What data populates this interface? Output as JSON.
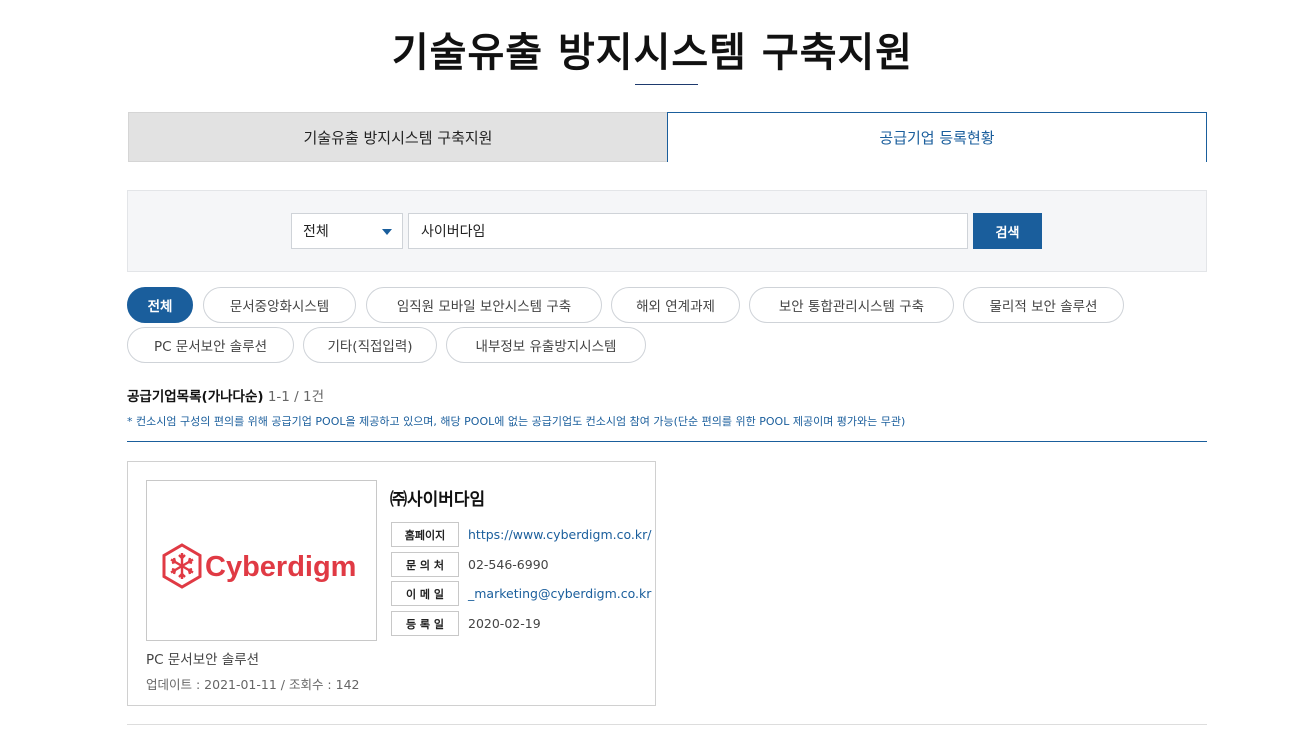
{
  "page": {
    "title": "기술유출 방지시스템 구축지원"
  },
  "tabs": [
    {
      "label": "기술유출 방지시스템 구축지원"
    },
    {
      "label": "공급기업 등록현황"
    }
  ],
  "search": {
    "select_value": "전체",
    "input_value": "사이버다임",
    "button_label": "검색"
  },
  "categories": [
    "전체",
    "문서중앙화시스템",
    "임직원 모바일 보안시스템 구축",
    "해외 연계과제",
    "보안 통합관리시스템 구축",
    "물리적 보안 솔루션",
    "PC 문서보안 솔루션",
    "기타(직접입력)",
    "내부정보 유출방지시스템"
  ],
  "list": {
    "title": "공급기업목록(가나다순)",
    "count": "1-1 / 1건",
    "notice": "* 컨소시엄 구성의 편의를 위해 공급기업 POOL을 제공하고 있으며, 해당 POOL에 없는 공급기업도 컨소시엄 참여 가능(단순 편의를 위한 POOL 제공이며 평가와는 무관)"
  },
  "company": {
    "name": "㈜사이버다임",
    "logo_text": "Cyberdigm",
    "info": [
      {
        "label": "홈페이지",
        "value": "https://www.cyberdigm.co.kr/"
      },
      {
        "label": "문 의 처",
        "value": "02-546-6990"
      },
      {
        "label": "이 메 일",
        "value": "_marketing@cyberdigm.co.kr"
      },
      {
        "label": "등 록 일",
        "value": "2020-02-19"
      }
    ],
    "category": "PC 문서보안 솔루션",
    "meta": "업데이트 : 2021-01-11 / 조회수 : 142"
  },
  "colors": {
    "accent": "#1a5e9c",
    "logo_red": "#e03a44"
  }
}
